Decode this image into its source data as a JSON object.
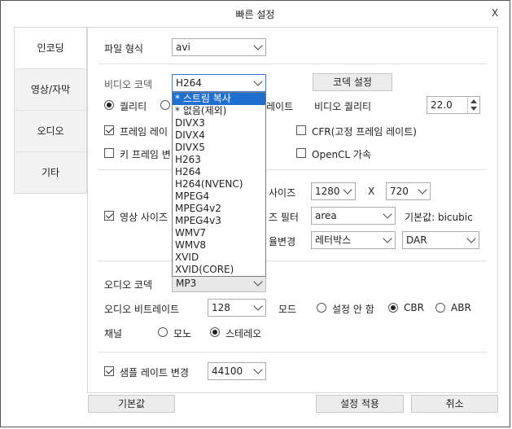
{
  "window": {
    "title": "빠른 설정",
    "close_label": "X"
  },
  "tabs": [
    {
      "label": "인코딩"
    },
    {
      "label": "영상/자막"
    },
    {
      "label": "오디오"
    },
    {
      "label": "기타"
    }
  ],
  "file_format": {
    "label": "파일 형식",
    "value": "avi"
  },
  "video_codec": {
    "label": "비디오 코덱",
    "value": "H264",
    "settings_button": "코덱 설정",
    "options": [
      "* 스트림 복사",
      "* 없음(제외)",
      "DIVX3",
      "DIVX4",
      "DIVX5",
      "H263",
      "H264",
      "H264(NVENC)",
      "MPEG4",
      "MPEG4v2",
      "MPEG4v3",
      "WMV7",
      "WMV8",
      "XVID",
      "XVID(CORE)"
    ],
    "highlighted_index": 0
  },
  "rate_control": {
    "quality_label": "퀄리티",
    "bitrate_tail": "레이트"
  },
  "video_quality": {
    "label": "비디오 퀄리티",
    "value": "22.0"
  },
  "frame_rate": {
    "label_visible": "프레임 레이"
  },
  "keyframe": {
    "label_visible": "키 프레임 변"
  },
  "cfr": {
    "label": "CFR(고정 프레임 레이트)"
  },
  "opencl": {
    "label": "OpenCL 가속"
  },
  "video_size": {
    "label": "영상 사이즈",
    "size_label_visible": "사이즈",
    "width": "1280",
    "x_label": "X",
    "height": "720",
    "filter_label_visible": "즈 필터",
    "filter_value": "area",
    "default_note": "기본값: bicubic",
    "ratio_label_visible": "율변경",
    "ratio_mode": "레터박스",
    "ratio_type": "DAR"
  },
  "audio": {
    "codec_label": "오디오 코덱",
    "codec_value": "MP3",
    "bitrate_label": "오디오 비트레이트",
    "bitrate_value": "128",
    "mode_label": "모드",
    "mode_none": "설정 안 함",
    "mode_cbr": "CBR",
    "mode_abr": "ABR",
    "channel_label": "채널",
    "channel_mono": "모노",
    "channel_stereo": "스테레오"
  },
  "sample_rate": {
    "label": "샘플 레이트 변경",
    "value": "44100"
  },
  "footer": {
    "default_button": "기본값",
    "apply_button": "설정 적용",
    "cancel_button": "취소"
  }
}
